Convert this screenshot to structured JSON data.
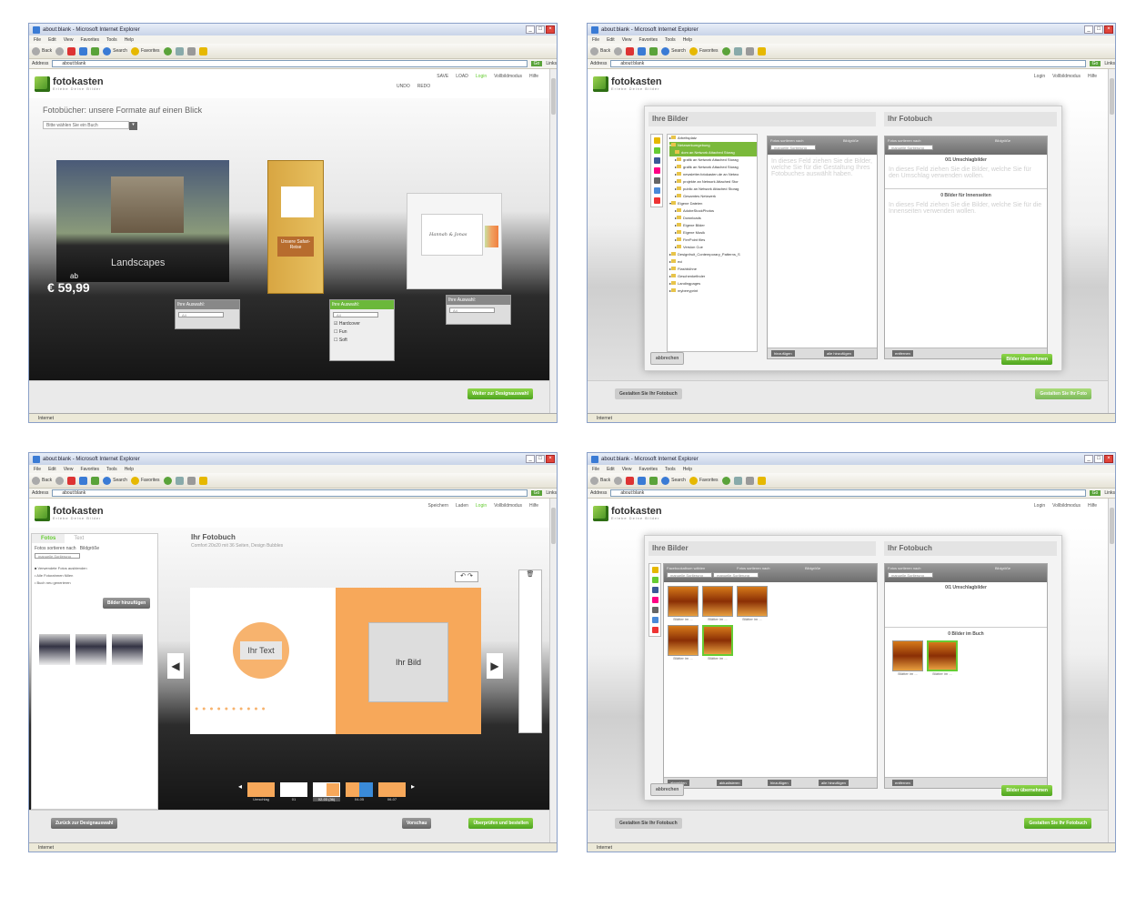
{
  "browser": {
    "title": "about:blank - Microsoft Internet Explorer",
    "menu": [
      "File",
      "Edit",
      "View",
      "Favorites",
      "Tools",
      "Help"
    ],
    "toolbar": {
      "back": "Back",
      "search": "Search",
      "favorites": "Favorites"
    },
    "address_label": "Address",
    "address_value": "about:blank",
    "go": "Go",
    "links": "Links",
    "status": "Internet"
  },
  "brand": {
    "name": "fotokasten",
    "tagline": "Erlebe Deine Bilder"
  },
  "s1": {
    "links": {
      "save": "SAVE",
      "load": "LOAD",
      "login": "Login",
      "fullscreen": "Vollbildmodus",
      "help": "Hilfe",
      "undo": "UNDO",
      "redo": "REDO"
    },
    "heading": "Fotobücher: unsere Formate auf einen Blick",
    "dropdown": "Bitte wählen Sie ein Buch",
    "book1_title": "Landscapes",
    "price_prefix": "ab",
    "price": "€ 59,99",
    "choice_label": "Ihre Auswahl:",
    "choice_value": "A4",
    "choice_value2": "A4",
    "opts": [
      "Hardcover",
      "Fun",
      "Soft"
    ],
    "book2_text": "Unsere Safari-Reise",
    "book3_text": "Hannah & Jonas",
    "next": "Weiter zur Designauswahl"
  },
  "s2": {
    "links": {
      "login": "Login",
      "fullscreen": "Vollbildmodus",
      "help": "Hilfe"
    },
    "left_title": "Ihre Bilder",
    "right_title": "Ihr Fotobuch",
    "tree": [
      "Arbeitsplatz",
      "Netzwerkumgebung",
      "dom an Network Attached Storag",
      "grafik an Network Attached Storag",
      "grafik an Network Attached Storag",
      "newsletter.fotokasten.de an Netwo",
      "projekte an Network Attached Stor",
      "public an Network Attached Storag",
      "Gesamtes Netzwerk",
      "Eigene Dateien",
      "AdobeStockPhotos",
      "Downloads",
      "Eigene Bilder",
      "Eigene Musik",
      "FirePoint files",
      "Version Cue",
      "Designfruit_Contemporary_Patterns_S",
      "eci",
      "Flashbühne",
      "Geschenkefinder",
      "Landingpages",
      "myberryprint"
    ],
    "sort_label": "Fotos sortieren nach",
    "size_label": "Bildgröße",
    "sort_value": "manuelle Sortierung",
    "hint_left": "In dieses Feld ziehen Sie die Bilder, welche Sie für die Gestaltung Ihres Fotobuches auswählt haben.",
    "cover_count": "0/1 Umschlagbilder",
    "cover_hint": "In dieses Feld ziehen Sie die Bilder, welche Sie für den Umschlag verwenden wollen.",
    "inner_count": "0 Bilder für Innenseiten",
    "inner_hint": "In dieses Feld ziehen Sie die Bilder, welche Sie für die Innenseiten verwenden wollen.",
    "add": "hinzufügen",
    "add_all": "alle hinzufügen",
    "remove": "entfernen",
    "cancel": "abbrechen",
    "accept": "Bilder übernehmen",
    "back": "Gestalten Sie Ihr Fotobuch",
    "next": "Gestalten Sie Ihr Foto"
  },
  "s3": {
    "links": {
      "save": "Speichern",
      "load": "Laden",
      "login": "Login",
      "fullscreen": "Vollbildmodus",
      "help": "Hilfe"
    },
    "tabs": [
      "Fotos",
      "Text"
    ],
    "sort_label": "Fotos sortieren nach",
    "size_label": "Bildgröße",
    "sort_value": "manuelle Sortierung",
    "checks": [
      "Verwendete Fotos ausblenden",
      "Alle Fotorahmen füllen",
      "Buch neu generieren"
    ],
    "add_images": "Bilder hinzufügen",
    "book_title": "Ihr Fotobuch",
    "book_sub": "Comfort 20x20 mit 36 Seiten, Design Bubbles",
    "text_ph": "Ihr Text",
    "image_ph": "Ihr Bild",
    "pages": [
      "Umschlag",
      "01",
      "02-03 (36)",
      "04-05",
      "06-07"
    ],
    "back": "Zurück zur Designauswahl",
    "preview": "Vorschau",
    "order": "Überprüfen und bestellen"
  },
  "s4": {
    "links": {
      "login": "Login",
      "fullscreen": "Vollbildmodus",
      "help": "Hilfe"
    },
    "left_title": "Ihre Bilder",
    "right_title": "Ihr Fotobuch",
    "fb_label": "Facebookalbum wählen",
    "sort_label": "Fotos sortieren nach",
    "size_label": "Bildgröße",
    "sort_value": "manuelle Sortierung",
    "photo_caption": "Blätter im ...",
    "cover_count": "0/1 Umschlagbilder",
    "inner_count": "0 Bilder im Buch",
    "logout": "abmelden",
    "refresh": "aktualisieren",
    "add": "hinzufügen",
    "add_all": "alle hinzufügen",
    "remove": "entfernen",
    "cancel": "abbrechen",
    "accept": "Bilder übernehmen",
    "back": "Gestalten Sie Ihr Fotobuch",
    "next": "Gestalten Sie Ihr Fotobuch"
  }
}
